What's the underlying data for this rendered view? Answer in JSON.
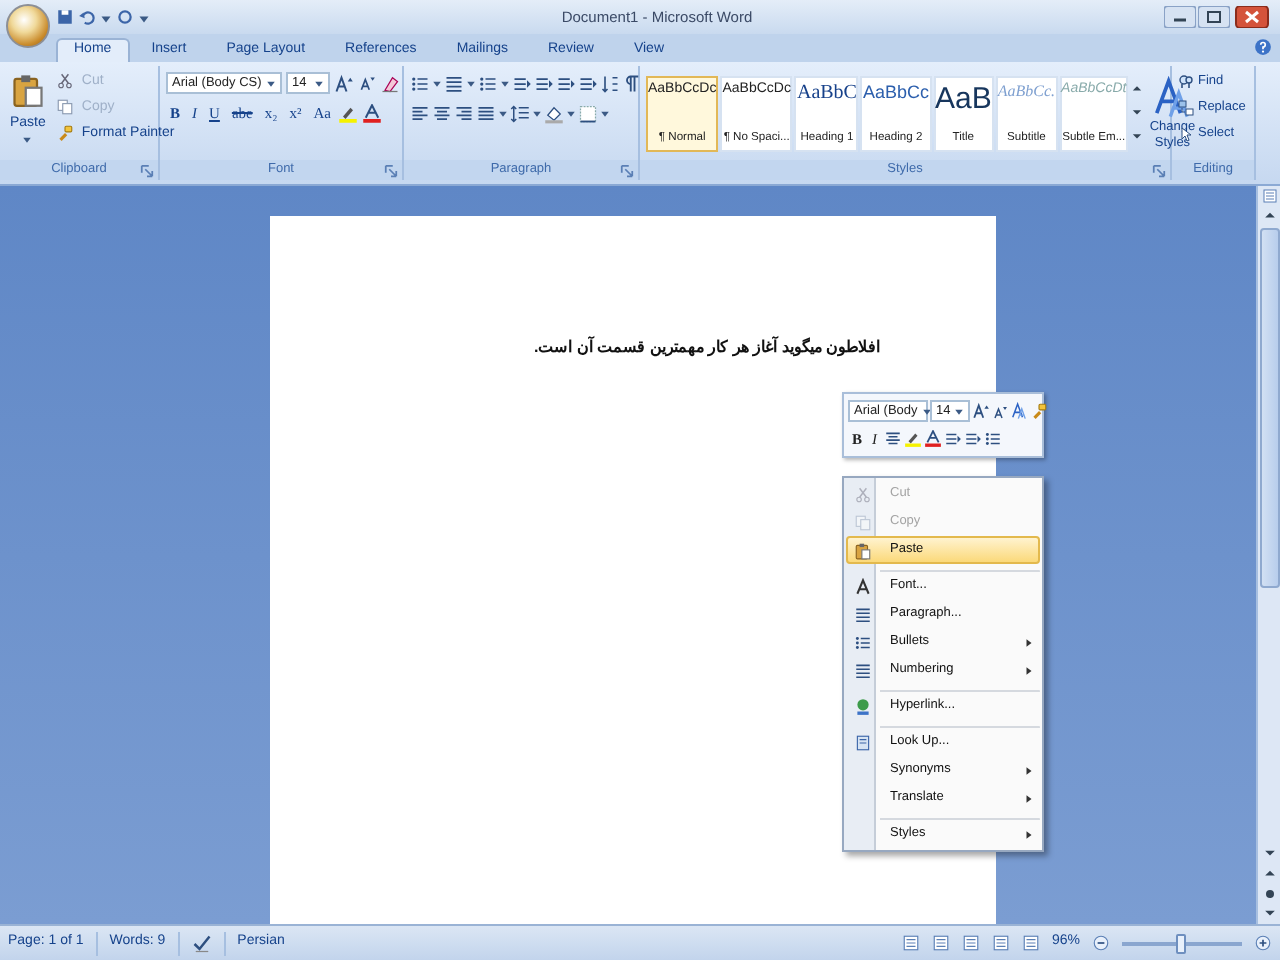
{
  "window": {
    "title": "Document1 - Microsoft Word"
  },
  "tabs": [
    {
      "label": "Home",
      "selected": true
    },
    {
      "label": "Insert",
      "selected": false
    },
    {
      "label": "Page Layout",
      "selected": false
    },
    {
      "label": "References",
      "selected": false
    },
    {
      "label": "Mailings",
      "selected": false
    },
    {
      "label": "Review",
      "selected": false
    },
    {
      "label": "View",
      "selected": false
    }
  ],
  "clipboard": {
    "label": "Clipboard",
    "paste": "Paste",
    "items": [
      {
        "label": "Cut",
        "disabled": true
      },
      {
        "label": "Copy",
        "disabled": true
      },
      {
        "label": "Format Painter",
        "disabled": false
      }
    ]
  },
  "font": {
    "label": "Font",
    "font_name": "Arial (Body CS)",
    "font_size": "14",
    "buttons": [
      "B",
      "I",
      "U",
      "abe",
      "x₂",
      "x²",
      "Aa"
    ]
  },
  "paragraph": {
    "label": "Paragraph"
  },
  "styles": {
    "label": "Styles",
    "items": [
      {
        "preview": "AaBbCcDc",
        "name": "¶ Normal",
        "selected": true
      },
      {
        "preview": "AaBbCcDc",
        "name": "¶ No Spaci...",
        "selected": false
      },
      {
        "preview": "AaBbC",
        "name": "Heading 1",
        "selected": false
      },
      {
        "preview": "AaBbCc",
        "name": "Heading 2",
        "selected": false
      },
      {
        "preview": "AaB",
        "name": "Title",
        "selected": false
      },
      {
        "preview": "AaBbCc.",
        "name": "Subtitle",
        "selected": false
      },
      {
        "preview": "AaBbCcDt",
        "name": "Subtle Em...",
        "selected": false
      }
    ],
    "change_styles": "Change Styles"
  },
  "editing": {
    "label": "Editing",
    "items": [
      "Find",
      "Replace",
      "Select"
    ]
  },
  "document": {
    "text": "افلاطون میگوید آغاز هر کار مهمترین قسمت آن است."
  },
  "mini_toolbar": {
    "font_name": "Arial (Body",
    "font_size": "14",
    "buttons": [
      "B",
      "I"
    ]
  },
  "context_menu": [
    {
      "label": "Cut",
      "disabled": true,
      "highlighted": false,
      "submenu": false,
      "separator_before": false
    },
    {
      "label": "Copy",
      "disabled": true,
      "highlighted": false,
      "submenu": false,
      "separator_before": false
    },
    {
      "label": "Paste",
      "disabled": false,
      "highlighted": true,
      "submenu": false,
      "separator_before": false
    },
    {
      "label": "Font...",
      "disabled": false,
      "highlighted": false,
      "submenu": false,
      "separator_before": true
    },
    {
      "label": "Paragraph...",
      "disabled": false,
      "highlighted": false,
      "submenu": false,
      "separator_before": false
    },
    {
      "label": "Bullets",
      "disabled": false,
      "highlighted": false,
      "submenu": true,
      "separator_before": false
    },
    {
      "label": "Numbering",
      "disabled": false,
      "highlighted": false,
      "submenu": true,
      "separator_before": false
    },
    {
      "label": "Hyperlink...",
      "disabled": false,
      "highlighted": false,
      "submenu": false,
      "separator_before": true
    },
    {
      "label": "Look Up...",
      "disabled": false,
      "highlighted": false,
      "submenu": false,
      "separator_before": true
    },
    {
      "label": "Synonyms",
      "disabled": false,
      "highlighted": false,
      "submenu": true,
      "separator_before": false
    },
    {
      "label": "Translate",
      "disabled": false,
      "highlighted": false,
      "submenu": true,
      "separator_before": false
    },
    {
      "label": "Styles",
      "disabled": false,
      "highlighted": false,
      "submenu": true,
      "separator_before": true
    }
  ],
  "status_bar": {
    "page": "Page: 1 of 1",
    "words": "Words: 9",
    "language": "Persian",
    "zoom": "96%",
    "zoom_slider": {
      "level": 0.5
    }
  }
}
